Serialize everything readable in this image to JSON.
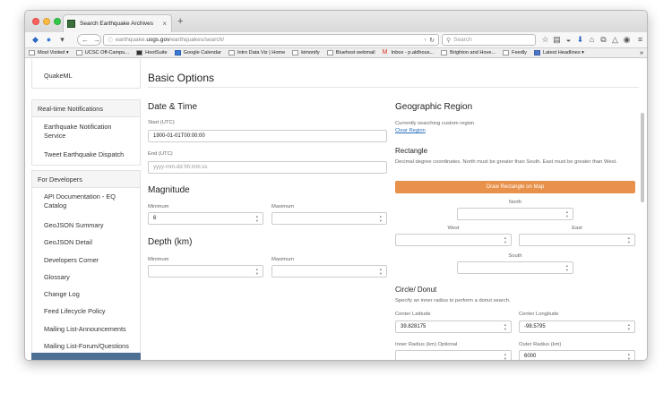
{
  "browser": {
    "tab_title": "Search Earthquake Archives",
    "tab_close": "×",
    "new_tab": "+",
    "url_prefix": "earthquake.",
    "url_domain": "usgs.gov",
    "url_path": "/earthquakes/search/",
    "search_placeholder": "Search",
    "bookmarks": [
      {
        "label": "Most Visited ▾"
      },
      {
        "label": "UCSC Off-Campu..."
      },
      {
        "label": "HootSuite"
      },
      {
        "label": "Google Calendar"
      },
      {
        "label": "Intro Data Viz | Home"
      },
      {
        "label": "kimonify"
      },
      {
        "label": "Bluehost webmail"
      },
      {
        "label": "Inbox - p.aldhous..."
      },
      {
        "label": "Brighton and Hove..."
      },
      {
        "label": "Feedly"
      },
      {
        "label": "Latest Headlines ▾"
      }
    ],
    "bookmarks_more": "»"
  },
  "sidebar": {
    "items_top": [
      {
        "label": "QuakeML"
      }
    ],
    "realtime": {
      "header": "Real-time Notifications",
      "items": [
        {
          "label": "Earthquake Notification Service"
        },
        {
          "label": "Tweet Earthquake Dispatch"
        }
      ]
    },
    "developers": {
      "header": "For Developers",
      "items": [
        {
          "label": "API Documentation - EQ Catalog"
        },
        {
          "label": "GeoJSON Summary"
        },
        {
          "label": "GeoJSON Detail"
        },
        {
          "label": "Developers Corner"
        },
        {
          "label": "Glossary"
        },
        {
          "label": "Change Log"
        },
        {
          "label": "Feed Lifecycle Policy"
        },
        {
          "label": "Mailing List-Announcements"
        },
        {
          "label": "Mailing List-Forum/Questions"
        }
      ]
    }
  },
  "main": {
    "title": "Basic Options",
    "datetime": {
      "heading": "Date & Time",
      "start_label": "Start (UTC)",
      "start_value": "1900-01-01T00:00:00",
      "end_label": "End (UTC)",
      "end_placeholder": "yyyy-mm-dd hh:mm:ss"
    },
    "magnitude": {
      "heading": "Magnitude",
      "min_label": "Minimum",
      "min_value": "6",
      "max_label": "Maximum",
      "max_value": ""
    },
    "depth": {
      "heading": "Depth (km)",
      "min_label": "Minimum",
      "min_value": "",
      "max_label": "Maximum",
      "max_value": ""
    },
    "geo": {
      "heading": "Geographic Region",
      "currently": "Currently searching custom region",
      "clear": "Clear Region",
      "rect_heading": "Rectangle",
      "rect_desc": "Decimal degree coordinates. North must be greater than South. East must be greater than West.",
      "draw_button": "Draw Rectangle on Map",
      "north": "North",
      "west": "West",
      "east": "East",
      "south": "South",
      "circle_heading": "Circle/ Donut",
      "circle_desc": "Specify an inner radius to perform a donut search.",
      "center_lat_label": "Center Latitude",
      "center_lat_value": "39.828175",
      "center_lon_label": "Center Longitude",
      "center_lon_value": "-98.5795",
      "inner_label": "Inner Radius (km) Optional",
      "inner_value": "",
      "outer_label": "Outer Radius (km)",
      "outer_value": "6000"
    }
  },
  "colors": {
    "accent_orange": "#e8914a",
    "link_blue": "#2a6ebb",
    "sidebar_bottom": "#4d6f94"
  }
}
